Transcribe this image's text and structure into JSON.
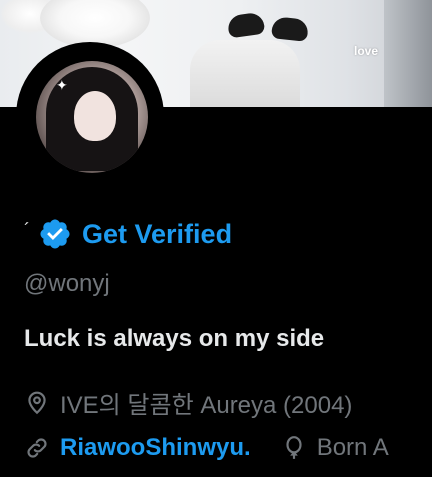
{
  "banner": {
    "overlay_text": "love"
  },
  "profile": {
    "name_mark": "´",
    "verified_label": "Get Verified",
    "handle": "@wonyj",
    "bio": "Luck is always on my side",
    "location": "IVE의 달콤한 Aureya (2004)",
    "link": "RiawooShinwyu.",
    "birth": "Born A"
  },
  "icons": {
    "verified": "verified-badge-icon",
    "location": "location-pin-icon",
    "link": "link-icon",
    "birth": "balloon-icon"
  },
  "colors": {
    "background": "#000000",
    "accent": "#1d9bf0",
    "text_primary": "#e7e9ea",
    "text_secondary": "#71767b"
  }
}
